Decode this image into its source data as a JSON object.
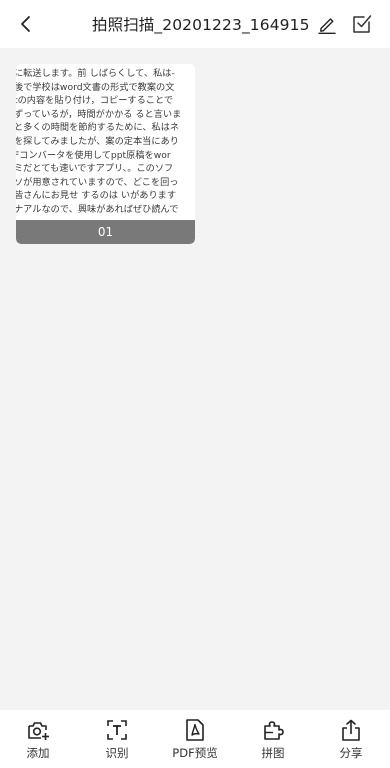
{
  "header": {
    "title": "拍照扫描_20201223_164915"
  },
  "pages": [
    {
      "label": "01",
      "lines": [
        "に転送します。前 しばらくして、私は-",
        "後で学校はword文書の形式で教案の文",
        "tの内容を貼り付け，コピーすることで",
        "ずっているが，時間がかかる ると言いま",
        "と多くの時間を節約するために、私はネ",
        "を探してみましたが、案の定本当にあり",
        "Fコンバータを使用してppt原稿をwor",
        "ミだとても速いですアプリ、。このソフ",
        "ソが用意されていますので、どこを回っ",
        "皆さんにお見せ するのは いがあります",
        "ナアルなので、興味があればぜひ読んで"
      ]
    }
  ],
  "toolbar": {
    "add": "添加",
    "ocr": "识别",
    "pdf_preview": "PDF预览",
    "collage": "拼图",
    "share": "分享"
  }
}
